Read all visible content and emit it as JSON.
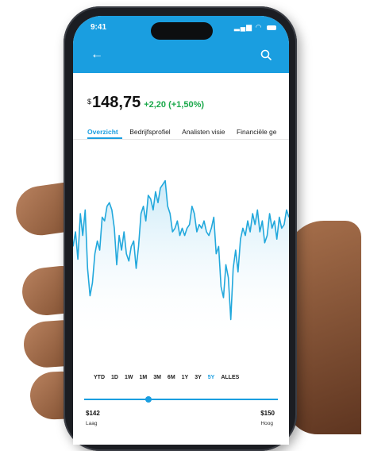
{
  "status": {
    "time": "9:41"
  },
  "stock": {
    "currency": "$",
    "price": "148,75",
    "change": "+2,20 (+1,50%)"
  },
  "tabs": [
    "Overzicht",
    "Bedrijfsprofiel",
    "Analisten visie",
    "Financiële ge"
  ],
  "ranges": [
    "YTD",
    "1D",
    "1W",
    "1M",
    "3M",
    "6M",
    "1Y",
    "3Y",
    "5Y",
    "ALLES"
  ],
  "active_range": "5Y",
  "range_slider": {
    "low_value": "$142",
    "low_label": "Laag",
    "high_value": "$150",
    "high_label": "Hoog",
    "position": 0.33
  },
  "colors": {
    "accent": "#1a9ee0",
    "positive": "#1aa84a",
    "line": "#22a8dc"
  },
  "icons": {
    "back": "arrow-left-icon",
    "search": "search-icon"
  },
  "chart_data": {
    "type": "area",
    "x": [
      0,
      1,
      2,
      3,
      4,
      5,
      6,
      7,
      8,
      9,
      10,
      11,
      12,
      13,
      14,
      15,
      16,
      17,
      18,
      19,
      20,
      21,
      22,
      23,
      24,
      25,
      26,
      27,
      28,
      29,
      30,
      31,
      32,
      33,
      34,
      35,
      36,
      37,
      38,
      39,
      40,
      41,
      42,
      43,
      44,
      45,
      46,
      47,
      48,
      49,
      50,
      51,
      52,
      53,
      54,
      55,
      56,
      57,
      58,
      59,
      60,
      61,
      62,
      63,
      64,
      65,
      66,
      67,
      68,
      69,
      70,
      71,
      72,
      73,
      74,
      75,
      76,
      77,
      78,
      79,
      80,
      81,
      82,
      83,
      84,
      85,
      86,
      87,
      88,
      89
    ],
    "y": [
      0.52,
      0.6,
      0.45,
      0.7,
      0.58,
      0.72,
      0.4,
      0.25,
      0.32,
      0.48,
      0.55,
      0.5,
      0.68,
      0.66,
      0.74,
      0.76,
      0.72,
      0.62,
      0.42,
      0.58,
      0.5,
      0.6,
      0.48,
      0.44,
      0.52,
      0.55,
      0.4,
      0.52,
      0.7,
      0.74,
      0.66,
      0.8,
      0.78,
      0.72,
      0.82,
      0.76,
      0.84,
      0.86,
      0.88,
      0.74,
      0.7,
      0.6,
      0.62,
      0.66,
      0.58,
      0.62,
      0.58,
      0.62,
      0.64,
      0.74,
      0.7,
      0.6,
      0.64,
      0.62,
      0.66,
      0.6,
      0.58,
      0.62,
      0.68,
      0.48,
      0.52,
      0.3,
      0.24,
      0.42,
      0.35,
      0.12,
      0.4,
      0.5,
      0.38,
      0.56,
      0.62,
      0.58,
      0.66,
      0.6,
      0.7,
      0.64,
      0.72,
      0.6,
      0.66,
      0.54,
      0.58,
      0.7,
      0.62,
      0.66,
      0.56,
      0.68,
      0.62,
      0.64,
      0.72,
      0.68
    ]
  }
}
